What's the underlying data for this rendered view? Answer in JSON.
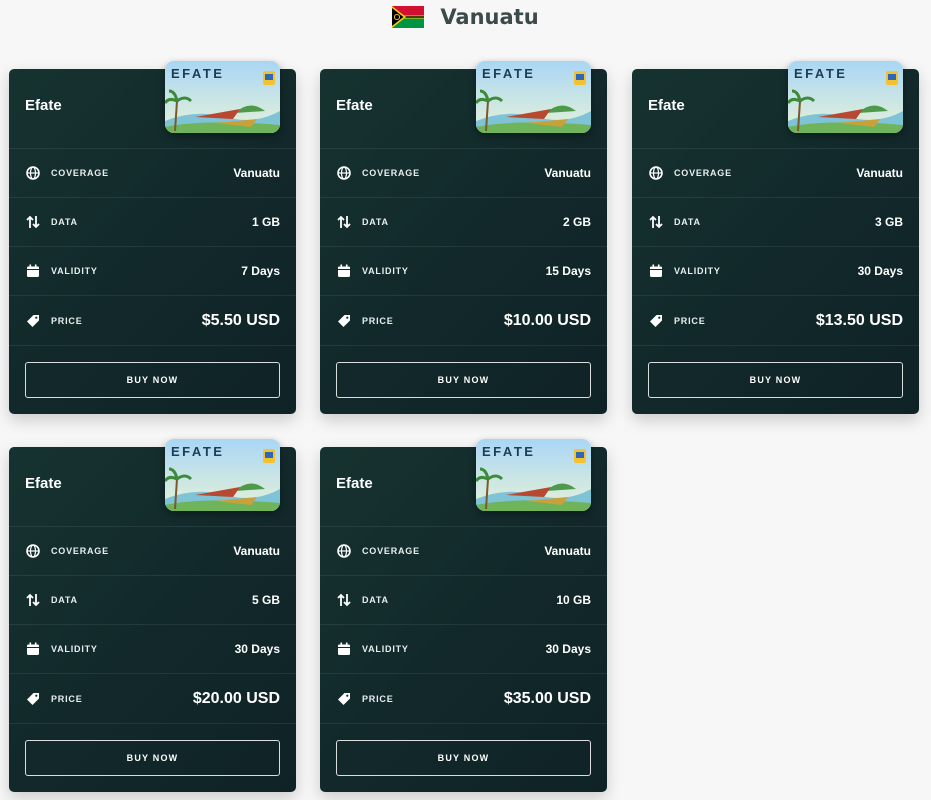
{
  "header": {
    "country": "Vanuatu",
    "flag_icon": "vanuatu-flag-icon"
  },
  "labels": {
    "coverage": "COVERAGE",
    "data": "DATA",
    "validity": "VALIDITY",
    "price": "PRICE",
    "buy": "BUY NOW",
    "image_text": "EFATE"
  },
  "icons": {
    "coverage": "globe-icon",
    "data": "arrows-up-down-icon",
    "validity": "calendar-icon",
    "price": "price-tag-icon"
  },
  "colors": {
    "card_bg": "#12282a",
    "page_bg": "#f7f7f7",
    "title_text": "#3d4a4a"
  },
  "plans": [
    {
      "name": "Efate",
      "coverage": "Vanuatu",
      "data": "1 GB",
      "validity": "7 Days",
      "price": "$5.50 USD"
    },
    {
      "name": "Efate",
      "coverage": "Vanuatu",
      "data": "2 GB",
      "validity": "15 Days",
      "price": "$10.00 USD"
    },
    {
      "name": "Efate",
      "coverage": "Vanuatu",
      "data": "3 GB",
      "validity": "30 Days",
      "price": "$13.50 USD"
    },
    {
      "name": "Efate",
      "coverage": "Vanuatu",
      "data": "5 GB",
      "validity": "30 Days",
      "price": "$20.00 USD"
    },
    {
      "name": "Efate",
      "coverage": "Vanuatu",
      "data": "10 GB",
      "validity": "30 Days",
      "price": "$35.00 USD"
    }
  ]
}
